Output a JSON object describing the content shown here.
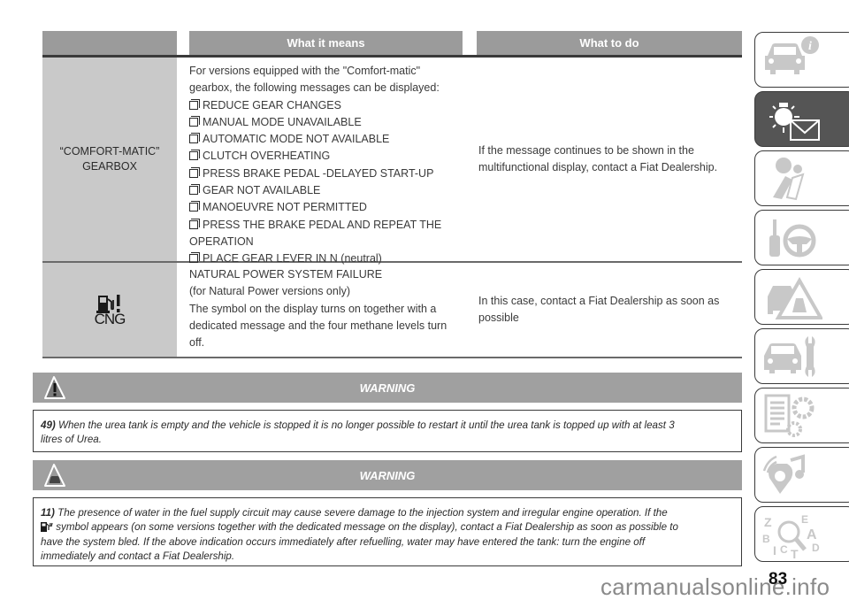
{
  "table": {
    "headers": [
      "",
      "What it means",
      "What to do"
    ],
    "rows": [
      {
        "label_line1": "“COMFORT-MATIC”",
        "label_line2": "GEARBOX",
        "meaning_intro_1": "For versions equipped with the \"Comfort-matic\"",
        "meaning_intro_2": "gearbox, the following messages can be displayed:",
        "messages": [
          "REDUCE GEAR CHANGES",
          "MANUAL MODE UNAVAILABLE",
          "AUTOMATIC MODE NOT AVAILABLE",
          "CLUTCH OVERHEATING",
          "PRESS BRAKE PEDAL -DELAYED START-UP",
          "GEAR NOT AVAILABLE",
          "MANOEUVRE NOT PERMITTED",
          "PRESS THE BRAKE PEDAL AND REPEAT THE",
          "PLACE GEAR LEVER IN N (neutral)"
        ],
        "messages_cont": "OPERATION",
        "action_1": "If the message continues to be shown in the",
        "action_2": "multifunctional display, contact a Fiat Dealership."
      },
      {
        "icon": "cng-fuel-warning-icon",
        "icon_label": "CNG",
        "meaning_lines": [
          "NATURAL POWER SYSTEM FAILURE",
          "(for Natural Power versions only)",
          "The symbol on the display turns on together with a",
          "dedicated message and the four methane levels turn",
          "off."
        ],
        "action_1": "In this case, contact a Fiat Dealership as soon as",
        "action_2": "possible"
      }
    ]
  },
  "warnings": [
    {
      "title": "WARNING",
      "icon": "warning-triangle-icon",
      "number": "49)",
      "text_1": "When the urea tank is empty and the vehicle is stopped it is no longer possible to restart it until the urea tank is topped up with at least 3",
      "text_2": "litres of Urea."
    },
    {
      "title": "WARNING",
      "icon": "car-triangle-icon",
      "number": "11)",
      "text_1": "The presence of water in the fuel supply circuit may cause severe damage to the injection system and irregular engine operation. If the",
      "text_2": "symbol appears (on some versions together with the dedicated message on the display), contact a Fiat Dealership as soon as possible to",
      "text_3": "have the system bled. If the above indication occurs immediately after refuelling, water may have entered the tank: turn the engine off",
      "text_4": "immediately and contact a Fiat Dealership."
    }
  ],
  "side_tabs": [
    {
      "icon": "car-info-icon",
      "active": false
    },
    {
      "icon": "warning-light-message-icon",
      "active": true
    },
    {
      "icon": "airbag-seatbelt-icon",
      "active": false
    },
    {
      "icon": "key-steering-wheel-icon",
      "active": false
    },
    {
      "icon": "car-breakdown-triangle-icon",
      "active": false
    },
    {
      "icon": "car-wrench-icon",
      "active": false
    },
    {
      "icon": "list-gears-icon",
      "active": false
    },
    {
      "icon": "music-location-icon",
      "active": false
    },
    {
      "icon": "alphabet-search-icon",
      "active": false
    }
  ],
  "page_number": "83",
  "watermark": "carmanualsonline.info",
  "colors": {
    "header_gray": "#9b9b9b",
    "label_cell_gray": "#c9c9c9",
    "active_tab": "#555555",
    "icon_gray": "#c8c8c8"
  }
}
